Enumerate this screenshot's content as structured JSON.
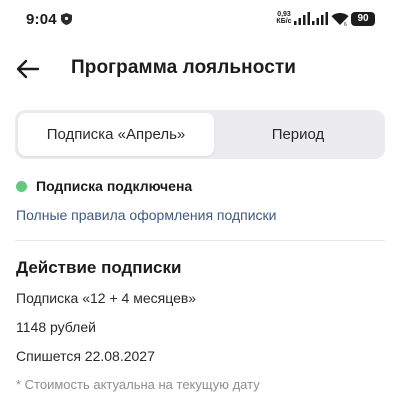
{
  "status_bar": {
    "time": "9:04",
    "net_speed_value": "0,93",
    "net_speed_unit": "КБ/с",
    "battery": "90"
  },
  "header": {
    "title": "Программа лояльности"
  },
  "tabs": [
    {
      "label": "Подписка «Апрель»",
      "selected": true
    },
    {
      "label": "Период",
      "selected": false
    }
  ],
  "subscription": {
    "status": "Подписка подключена",
    "status_color": "#5ec97f",
    "rules_link": "Полные правила оформления подписки"
  },
  "action": {
    "title": "Действие подписки",
    "plan": "Подписка «12 + 4 месяцев»",
    "price": "1148 рублей",
    "charge_date": "Спишется 22.08.2027",
    "note": "* Стоимость актуальна на текущую дату"
  }
}
